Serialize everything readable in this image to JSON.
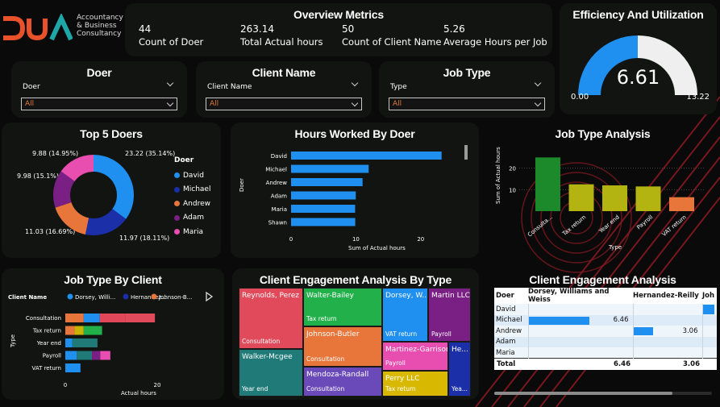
{
  "brand": {
    "logo_text": "DUA",
    "line1": "Accountancy",
    "line2": "& Business",
    "line3": "Consultancy"
  },
  "overview": {
    "title": "Overview Metrics",
    "metrics": [
      {
        "value": "44",
        "label": "Count of Doer"
      },
      {
        "value": "263.14",
        "label": "Total Actual hours"
      },
      {
        "value": "50",
        "label": "Count of Client Name"
      },
      {
        "value": "5.26",
        "label": "Average Hours per Job"
      }
    ]
  },
  "efficiency": {
    "title": "Efficiency And Utilization",
    "value": "6.61",
    "min": "0.00",
    "max": "13.22",
    "fraction": 0.5
  },
  "slicers": [
    {
      "title": "Doer",
      "field": "Doer",
      "value": "All"
    },
    {
      "title": "Client Name",
      "field": "Client Name",
      "value": "All"
    },
    {
      "title": "Job Type",
      "field": "Type",
      "value": "All"
    }
  ],
  "top5": {
    "title": "Top 5 Doers",
    "legend_title": "Doer",
    "labels": [
      "23.22 (35.14%)",
      "11.97 (18.11%)",
      "11.03 (16.69%)",
      "9.98 (15.1%)",
      "9.88 (14.95%)"
    ]
  },
  "hours_by_doer": {
    "title": "Hours Worked By Doer",
    "ylabel": "Doer",
    "xlabel": "Sum of Actual hours"
  },
  "job_type_analysis": {
    "title": "Job Type Analysis",
    "ylabel": "Sum of Actual hours",
    "xlabel": "Type"
  },
  "job_type_by_client": {
    "title": "Job Type By Client",
    "legend_title": "Client Name",
    "ylabel": "Type",
    "xlabel": "Actual hours",
    "legend": [
      "Dorsey, Willi...",
      "Hernandez...",
      "Johnson-B..."
    ]
  },
  "treemap": {
    "title": "Client Engagement Analysis By Type",
    "tiles": [
      {
        "name": "Reynolds, Perez ...",
        "type": "Consultation",
        "color": "#e04a5a"
      },
      {
        "name": "Walter-Bailey",
        "type": "Tax return",
        "color": "#22b04a"
      },
      {
        "name": "Dorsey, W...",
        "type": "VAT return",
        "color": "#1f8ff0"
      },
      {
        "name": "Martin LLC",
        "type": "Payroll",
        "color": "#7a1f84"
      },
      {
        "name": "Walker-Mcgee",
        "type": "Year end",
        "color": "#1f7a78"
      },
      {
        "name": "Johnson-Butler",
        "type": "Consultation",
        "color": "#e8753a"
      },
      {
        "name": "Martinez-Garrison",
        "type": "Payroll",
        "color": "#e84db0"
      },
      {
        "name": "He...",
        "type": "Yea...",
        "color": "#1a2fa8"
      },
      {
        "name": "Mendoza-Randall",
        "type": "Consultation",
        "color": "#6a4ab8"
      },
      {
        "name": "Perry LLC",
        "type": "Tax return",
        "color": "#d8b800"
      }
    ]
  },
  "engagement": {
    "title": "Client Engagement Analysis",
    "headers": [
      "Doer",
      "Dorsey, Williams and Weiss",
      "Hernandez-Reilly",
      "Joh"
    ],
    "rows": [
      {
        "doer": "David",
        "c1": "",
        "c2": "",
        "c3": ""
      },
      {
        "doer": "Michael",
        "c1": "6.46",
        "c2": "",
        "c3": ""
      },
      {
        "doer": "Andrew",
        "c1": "",
        "c2": "3.06",
        "c3": ""
      },
      {
        "doer": "Adam",
        "c1": "",
        "c2": "",
        "c3": ""
      },
      {
        "doer": "Maria",
        "c1": "",
        "c2": "",
        "c3": ""
      }
    ],
    "total": {
      "doer": "Total",
      "c1": "6.46",
      "c2": "3.06",
      "c3": ""
    }
  },
  "colors": {
    "accent": "#1f8ff0",
    "brand_orange": "#e8522a",
    "brand_teal": "#1ea6a8",
    "card": "#121412"
  },
  "chart_data": [
    {
      "type": "pie",
      "title": "Top 5 Doers",
      "legend_title": "Doer",
      "categories": [
        "David",
        "Michael",
        "Andrew",
        "Adam",
        "Maria"
      ],
      "values": [
        23.22,
        11.97,
        11.03,
        9.98,
        9.88
      ],
      "percents": [
        35.14,
        18.11,
        16.69,
        15.1,
        14.95
      ],
      "colors": [
        "#1f8ff0",
        "#1a2fa8",
        "#e8753a",
        "#7a1f84",
        "#e84db0"
      ]
    },
    {
      "type": "bar",
      "orientation": "horizontal",
      "title": "Hours Worked By Doer",
      "xlabel": "Sum of Actual hours",
      "ylabel": "Doer",
      "categories": [
        "David",
        "Michael",
        "Andrew",
        "Adam",
        "Maria",
        "Shawn"
      ],
      "values": [
        23.22,
        11.97,
        11.03,
        9.98,
        9.88,
        9.9
      ],
      "xlim": [
        0,
        25
      ],
      "xticks": [
        0,
        10,
        20
      ]
    },
    {
      "type": "bar",
      "title": "Job Type Analysis",
      "xlabel": "Type",
      "ylabel": "Sum of Actual hours",
      "categories": [
        "Consulta...",
        "Tax return",
        "Year end",
        "Payroll",
        "VAT return"
      ],
      "values": [
        25,
        12.5,
        12,
        11.5,
        6.5
      ],
      "ylim": [
        0,
        30
      ],
      "yticks": [
        0,
        10,
        20
      ],
      "colors": [
        "#1c8a2a",
        "#b3b312",
        "#b3b312",
        "#b3b312",
        "#e8753a"
      ]
    },
    {
      "type": "bar",
      "orientation": "horizontal",
      "stacked": true,
      "title": "Job Type By Client",
      "xlabel": "Actual hours",
      "ylabel": "Type",
      "categories": [
        "Consultation",
        "Tax return",
        "Year end",
        "Payroll",
        "VAT return"
      ],
      "xlim": [
        0,
        30
      ],
      "xticks": [
        0,
        20
      ],
      "series": [
        {
          "values": [
            4,
            2,
            0,
            0,
            0
          ],
          "color": "#e8753a"
        },
        {
          "values": [
            3.5,
            0,
            1.5,
            2.5,
            3.3
          ],
          "color": "#1f8ff0"
        },
        {
          "values": [
            5.5,
            0,
            0,
            0,
            0
          ],
          "color": "#e0485a"
        },
        {
          "values": [
            0,
            2,
            0,
            0,
            0
          ],
          "color": "#c8b400"
        },
        {
          "values": [
            0,
            4,
            0,
            0,
            0
          ],
          "color": "#22b04a"
        },
        {
          "values": [
            0,
            0,
            5.5,
            3.3,
            0
          ],
          "color": "#1f7a78"
        },
        {
          "values": [
            0,
            0,
            0,
            1.8,
            0
          ],
          "color": "#7a1f84"
        },
        {
          "values": [
            0,
            0,
            0,
            2.2,
            0
          ],
          "color": "#e84db0"
        },
        {
          "values": [
            6.5,
            0,
            0,
            0,
            0
          ],
          "color": "#e04a5a"
        }
      ]
    },
    {
      "type": "table",
      "title": "Client Engagement Analysis",
      "columns": [
        "Doer",
        "Dorsey, Williams and Weiss",
        "Hernandez-Reilly"
      ],
      "rows": [
        [
          "David",
          "",
          ""
        ],
        [
          "Michael",
          "6.46",
          ""
        ],
        [
          "Andrew",
          "",
          "3.06"
        ],
        [
          "Adam",
          "",
          ""
        ],
        [
          "Maria",
          "",
          ""
        ],
        [
          "Total",
          "6.46",
          "3.06"
        ]
      ]
    }
  ]
}
